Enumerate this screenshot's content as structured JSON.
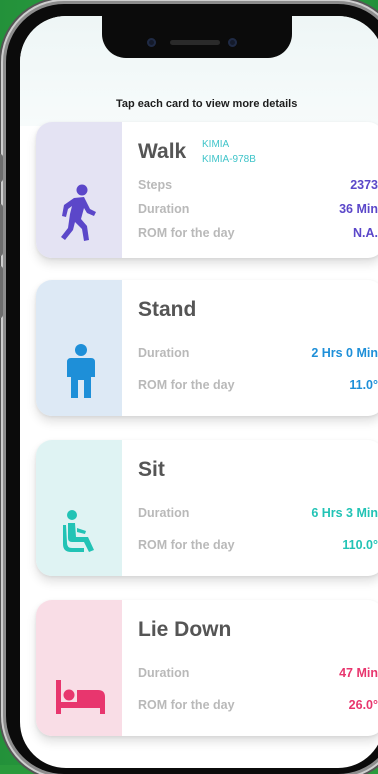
{
  "hint_text": "Tap each card to view more details",
  "colors": {
    "walk": "#5b47c9",
    "stand": "#1e8fd8",
    "sit": "#22c3b5",
    "lie": "#e8366e"
  },
  "cards": [
    {
      "title": "Walk",
      "icon": "walking-person-icon",
      "device_lines": [
        "KIMIA",
        "KIMIA-978B"
      ],
      "rows": [
        {
          "label": "Steps",
          "value": "2373"
        },
        {
          "label": "Duration",
          "value": "36 Min"
        },
        {
          "label": "ROM for the day",
          "value": "N.A."
        }
      ]
    },
    {
      "title": "Stand",
      "icon": "standing-person-icon",
      "rows": [
        {
          "label": "Duration",
          "value": "2 Hrs 0 Min"
        },
        {
          "label": "ROM for the day",
          "value": "11.0°"
        }
      ]
    },
    {
      "title": "Sit",
      "icon": "seated-person-icon",
      "rows": [
        {
          "label": "Duration",
          "value": "6 Hrs 3 Min"
        },
        {
          "label": "ROM for the day",
          "value": "110.0°"
        }
      ]
    },
    {
      "title": "Lie Down",
      "icon": "bed-icon",
      "rows": [
        {
          "label": "Duration",
          "value": "47 Min"
        },
        {
          "label": "ROM for the day",
          "value": "26.0°"
        }
      ]
    }
  ]
}
